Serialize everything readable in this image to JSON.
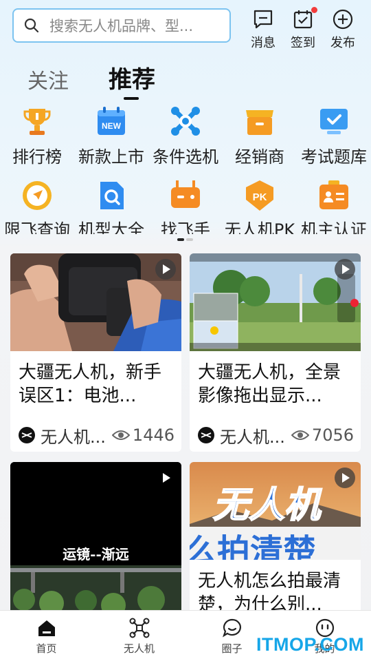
{
  "header": {
    "search_placeholder": "搜索无人机品牌、型...",
    "actions": [
      {
        "label": "消息",
        "icon": "message-icon"
      },
      {
        "label": "签到",
        "icon": "checkin-icon",
        "badge": true
      },
      {
        "label": "发布",
        "icon": "plus-circle-icon"
      }
    ]
  },
  "tabs": [
    {
      "label": "关注",
      "active": false
    },
    {
      "label": "推荐",
      "active": true
    }
  ],
  "categories": {
    "row1": [
      {
        "label": "排行榜",
        "icon": "trophy-icon",
        "color": "#f5a623"
      },
      {
        "label": "新款上市",
        "icon": "new-calendar-icon",
        "color": "#2f8cf0"
      },
      {
        "label": "条件选机",
        "icon": "drone-icon",
        "color": "#1f8fe6"
      },
      {
        "label": "经销商",
        "icon": "store-icon",
        "color": "#f59b23"
      },
      {
        "label": "考试题库",
        "icon": "monitor-check-icon",
        "color": "#3a9cf2"
      }
    ],
    "row2": [
      {
        "label": "限飞查询",
        "icon": "compass-icon",
        "color": "#f5a623"
      },
      {
        "label": "机型大全",
        "icon": "search-doc-icon",
        "color": "#2f8cf0"
      },
      {
        "label": "找飞手",
        "icon": "controller-icon",
        "color": "#f58b23"
      },
      {
        "label": "无人机PK",
        "icon": "pk-shield-icon",
        "color": "#f59b23"
      },
      {
        "label": "机主认证",
        "icon": "id-card-icon",
        "color": "#f58b23"
      }
    ]
  },
  "feed": [
    {
      "title": "大疆无人机，新手误区1：电池...",
      "author": "无人机...",
      "views": "1446"
    },
    {
      "title": "大疆无人机，全景影像拖出显示...",
      "author": "无人机...",
      "views": "7056"
    },
    {
      "title": "",
      "overlay_text": "运镜--渐远"
    },
    {
      "title": "无人机怎么拍最清楚，为什么别...",
      "overlay_text_1": "无人机",
      "overlay_text_2": "么拍清楚"
    }
  ],
  "bottom_nav": [
    {
      "label": "首页",
      "icon": "home-icon",
      "active": true
    },
    {
      "label": "无人机",
      "icon": "drone-outline-icon"
    },
    {
      "label": "圈子",
      "icon": "chat-icon"
    },
    {
      "label": "我的",
      "icon": "smile-icon"
    }
  ],
  "watermark": "ITMOP.COM"
}
